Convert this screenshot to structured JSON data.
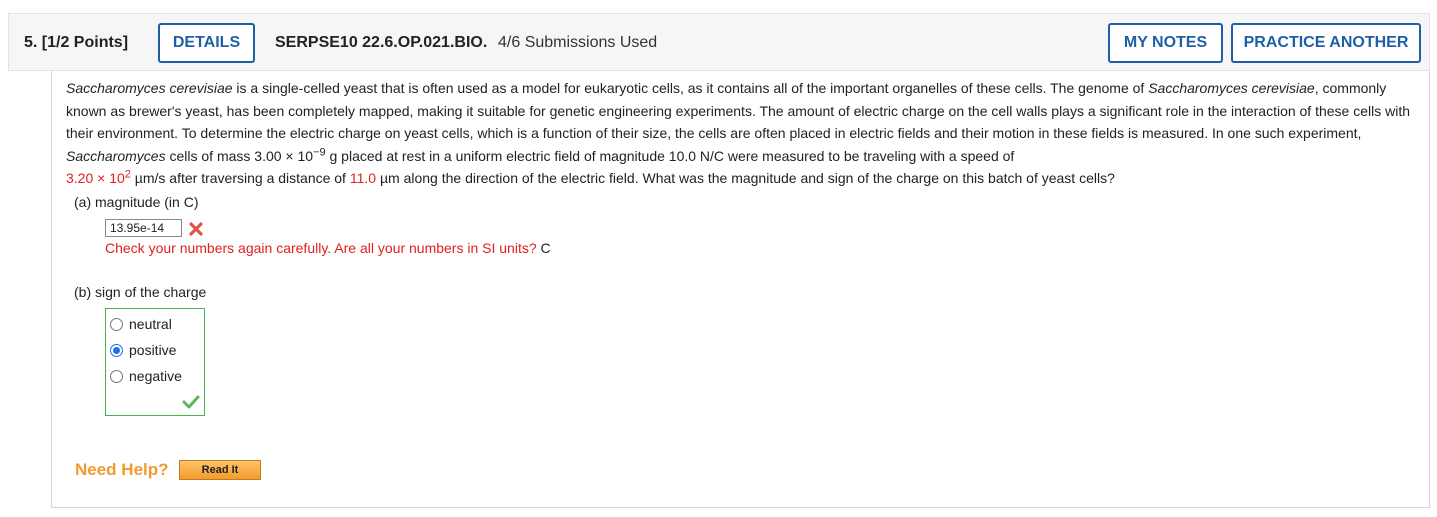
{
  "header": {
    "question_number": "5.  [1/2 Points]",
    "details_label": "DETAILS",
    "code": "SERPSE10 22.6.OP.021.BIO.",
    "submissions": "4/6 Submissions Used",
    "notes_label": "MY NOTES",
    "practice_label": "PRACTICE ANOTHER"
  },
  "problem": {
    "t1": "Saccharomyces cerevisiae",
    "t2": " is a single-celled yeast that is often used as a model for eukaryotic cells, as it contains all of the important organelles of these cells. The genome of ",
    "t3": "Saccharomyces cerevisiae",
    "t4": ", commonly known as brewer's yeast, has been completely mapped, making it suitable for genetic engineering experiments. The amount of electric charge on the cell walls plays a significant role in the interaction of these cells with their environment. To determine the electric charge on yeast cells, which is a function of their size, the cells are often placed in electric fields and their motion in these fields is measured. In one such experiment, ",
    "t5": "Saccharomyces",
    "t6": " cells of mass 3.00 × 10",
    "t6_exp": "−9",
    "t7": " g placed at rest in a uniform electric field of magnitude 10.0 N/C were measured to be traveling with a speed of ",
    "speed_mantissa": "3.20 × 10",
    "speed_exp": "2",
    "t8": " µm/s after traversing a distance of ",
    "distance": "11.0",
    "t9": " µm along the direction of the electric field. What was the magnitude and sign of the charge on this batch of yeast cells?"
  },
  "part_a": {
    "label": "(a)   magnitude (in C)",
    "value": "13.95e-14",
    "feedback": "Check your numbers again carefully. Are all your numbers in SI units?",
    "unit": "C"
  },
  "part_b": {
    "label": "(b)   sign of the charge",
    "options": [
      "neutral",
      "positive",
      "negative"
    ],
    "selected": "positive"
  },
  "help": {
    "label": "Need Help?",
    "read_it": "Read It"
  },
  "colors": {
    "accent": "#1f5fa8",
    "error": "#e02020",
    "success": "#4caf50",
    "help": "#f29a2e"
  },
  "icons": [
    "x-icon",
    "check-icon"
  ]
}
